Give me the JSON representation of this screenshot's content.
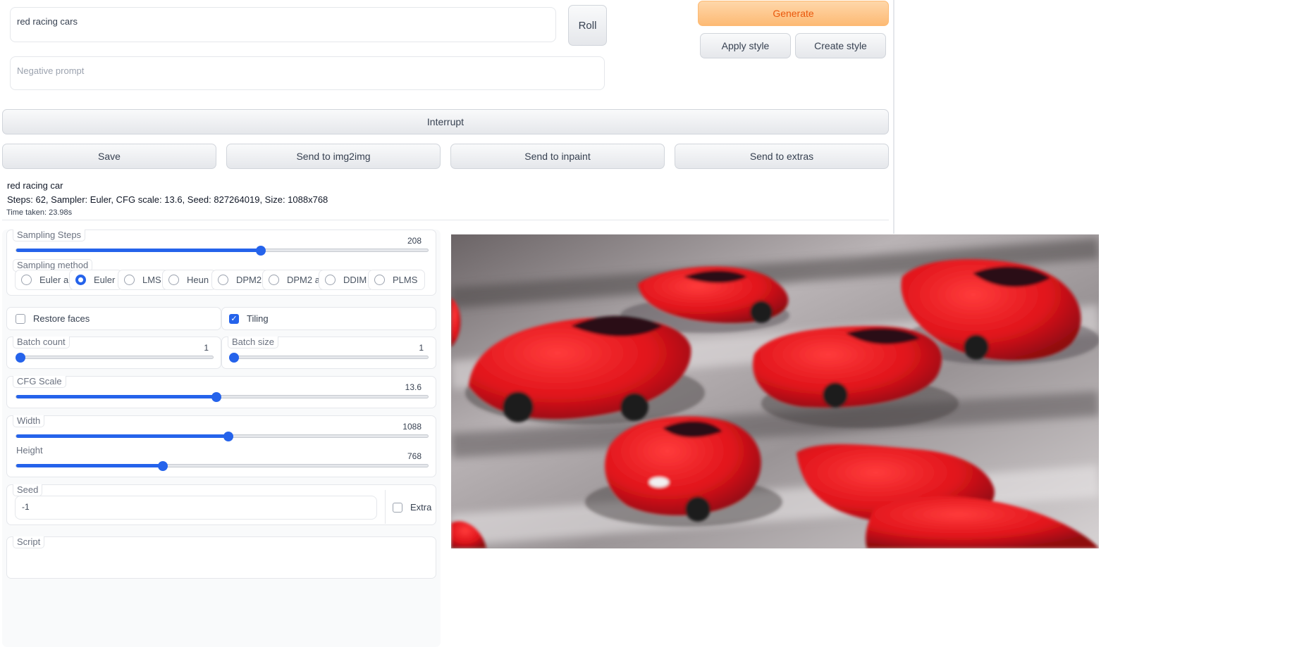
{
  "prompt": {
    "value": "red racing cars",
    "negative_placeholder": "Negative prompt"
  },
  "buttons": {
    "roll": "Roll",
    "generate": "Generate",
    "apply_style": "Apply style",
    "create_style": "Create style",
    "interrupt": "Interrupt",
    "save": "Save",
    "send_img2img": "Send to img2img",
    "send_inpaint": "Send to inpaint",
    "send_extras": "Send to extras"
  },
  "info": {
    "title": "red racing car",
    "params": "Steps: 62, Sampler: Euler, CFG scale: 13.6, Seed: 827264019, Size: 1088x768",
    "time": "Time taken: 23.98s"
  },
  "sampling_steps": {
    "label": "Sampling Steps",
    "value": "208",
    "fraction": 0.595
  },
  "sampling_method": {
    "label": "Sampling method",
    "options": [
      "Euler a",
      "Euler",
      "LMS",
      "Heun",
      "DPM2",
      "DPM2 a",
      "DDIM",
      "PLMS"
    ],
    "selected": "Euler"
  },
  "restore_faces": {
    "label": "Restore faces",
    "checked": false
  },
  "tiling": {
    "label": "Tiling",
    "checked": true
  },
  "batch_count": {
    "label": "Batch count",
    "value": "1",
    "fraction": 0.0
  },
  "batch_size": {
    "label": "Batch size",
    "value": "1",
    "fraction": 0.0
  },
  "cfg_scale": {
    "label": "CFG Scale",
    "value": "13.6",
    "fraction": 0.487
  },
  "width": {
    "label": "Width",
    "value": "1088",
    "fraction": 0.515
  },
  "height": {
    "label": "Height",
    "value": "768",
    "fraction": 0.357
  },
  "seed": {
    "label": "Seed",
    "value": "-1",
    "extra_label": "Extra"
  },
  "script": {
    "label": "Script"
  },
  "colors": {
    "accent": "#2563eb",
    "generate": "#ea580c",
    "car_red": "#e0141b"
  }
}
